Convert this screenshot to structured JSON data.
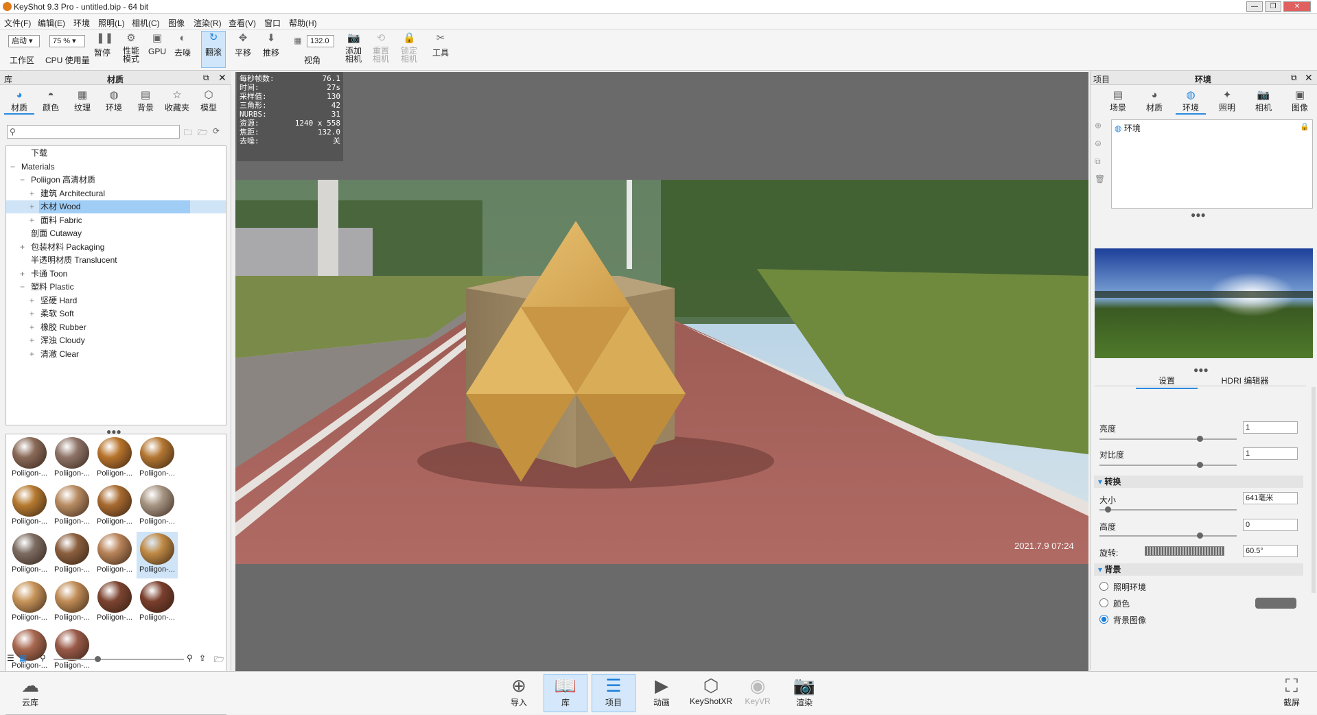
{
  "window": {
    "title": "KeyShot 9.3 Pro  - untitled.bip  - 64 bit"
  },
  "menu": [
    "文件(F)",
    "编辑(E)",
    "环境",
    "照明(L)",
    "相机(C)",
    "图像",
    "渲染(R)",
    "查看(V)",
    "窗口",
    "帮助(H)"
  ],
  "toolbar": {
    "workspace_value": "启动",
    "workspace_label": "工作区",
    "cpu_value": "75 %",
    "cpu_label": "CPU 使用量",
    "pause_label": "暂停",
    "perf_label": "性能\n模式",
    "gpu_label": "GPU",
    "denoise_label": "去噪",
    "tumble_label": "翻滚",
    "pan_label": "平移",
    "dolly_label": "推移",
    "fov_value": "132.0",
    "fov_label": "视角",
    "add_camera_label": "添加\n相机",
    "reset_camera_label": "重置\n相机",
    "lock_camera_label": "锁定\n相机",
    "tools_label": "工具"
  },
  "library": {
    "header_left": "库",
    "header_title": "材质",
    "tabs": [
      "材质",
      "颜色",
      "纹理",
      "环境",
      "背景",
      "收藏夹",
      "模型"
    ],
    "search_placeholder": "",
    "tree": [
      {
        "label": "下载",
        "indent": 1,
        "toggle": ""
      },
      {
        "label": "Materials",
        "indent": 0,
        "toggle": "−"
      },
      {
        "label": "Poliigon 高清材质",
        "indent": 1,
        "toggle": "−"
      },
      {
        "label": "建筑 Architectural",
        "indent": 2,
        "toggle": "+"
      },
      {
        "label": "木材 Wood",
        "indent": 2,
        "toggle": "+",
        "selected": true
      },
      {
        "label": "面料 Fabric",
        "indent": 2,
        "toggle": "+"
      },
      {
        "label": "剖面 Cutaway",
        "indent": 1,
        "toggle": ""
      },
      {
        "label": "包装材料 Packaging",
        "indent": 1,
        "toggle": "+"
      },
      {
        "label": "半透明材质 Translucent",
        "indent": 1,
        "toggle": ""
      },
      {
        "label": "卡通 Toon",
        "indent": 1,
        "toggle": "+"
      },
      {
        "label": "塑料 Plastic",
        "indent": 1,
        "toggle": "−"
      },
      {
        "label": "坚硬 Hard",
        "indent": 2,
        "toggle": "+"
      },
      {
        "label": "柔软 Soft",
        "indent": 2,
        "toggle": "+"
      },
      {
        "label": "橡胶 Rubber",
        "indent": 2,
        "toggle": "+"
      },
      {
        "label": "浑浊 Cloudy",
        "indent": 2,
        "toggle": "+"
      },
      {
        "label": "清澈 Clear",
        "indent": 2,
        "toggle": "+"
      }
    ],
    "thumbs": [
      {
        "label": "Poliigon-...",
        "color": "#8a6a58"
      },
      {
        "label": "Poliigon-...",
        "color": "#8f7468"
      },
      {
        "label": "Poliigon-...",
        "color": "#b8742c"
      },
      {
        "label": "Poliigon-...",
        "color": "#b47732"
      },
      {
        "label": "Poliigon-...",
        "color": "#b67a30"
      },
      {
        "label": "Poliigon-...",
        "color": "#b88c62"
      },
      {
        "label": "Poliigon-...",
        "color": "#a86a30"
      },
      {
        "label": "Poliigon-...",
        "color": "#a89684"
      },
      {
        "label": "Poliigon-...",
        "color": "#7c6c62"
      },
      {
        "label": "Poliigon-...",
        "color": "#8b5f3e"
      },
      {
        "label": "Poliigon-...",
        "color": "#b88358"
      },
      {
        "label": "Poliigon-...",
        "color": "#c08a45",
        "selected": true
      },
      {
        "label": "Poliigon-...",
        "color": "#c8955a"
      },
      {
        "label": "Poliigon-...",
        "color": "#c08c56"
      },
      {
        "label": "Poliigon-...",
        "color": "#7c4430"
      },
      {
        "label": "Poliigon-...",
        "color": "#7a3e2c"
      },
      {
        "label": "Poliigon-...",
        "color": "#a86850"
      },
      {
        "label": "Poliigon-...",
        "color": "#9a5a48"
      }
    ]
  },
  "stats": [
    {
      "k": "每秒帧数:",
      "v": "76.1"
    },
    {
      "k": "时间:",
      "v": "27s"
    },
    {
      "k": "采样值:",
      "v": "130"
    },
    {
      "k": "三角形:",
      "v": "42"
    },
    {
      "k": "NURBS:",
      "v": "31"
    },
    {
      "k": "资源:",
      "v": "1240 x 558"
    },
    {
      "k": "焦距:",
      "v": "132.0"
    },
    {
      "k": "去噪:",
      "v": "关"
    }
  ],
  "viewport": {
    "timestamp": "2021.7.9 07:24"
  },
  "project": {
    "header_left": "项目",
    "header_title": "环境",
    "tabs": [
      "场景",
      "材质",
      "环境",
      "照明",
      "相机",
      "图像"
    ],
    "env_list": [
      "环境"
    ],
    "subtabs": [
      "设置",
      "HDRI 编辑器"
    ],
    "brightness_label": "亮度",
    "brightness_value": "1",
    "contrast_label": "对比度",
    "contrast_value": "1",
    "transform_title": "转换",
    "size_label": "大小",
    "size_value": "641毫米",
    "height_label": "高度",
    "height_value": "0",
    "rotation_label": "旋转:",
    "rotation_value": "60.5°",
    "background_title": "背景",
    "bg_options": [
      "照明环境",
      "颜色",
      "背景图像"
    ],
    "bg_selected": 2,
    "bg_color": "#6e6e6e"
  },
  "bottom": {
    "cloud_label": "云库",
    "import_label": "导入",
    "library_label": "库",
    "project_label": "项目",
    "animation_label": "动画",
    "keyshotxr_label": "KeyShotXR",
    "keyvr_label": "KeyVR",
    "render_label": "渲染",
    "screenshot_label": "截屏"
  },
  "colors": {
    "accent": "#2a8ae0",
    "selected_row": "#9fcdf6"
  }
}
